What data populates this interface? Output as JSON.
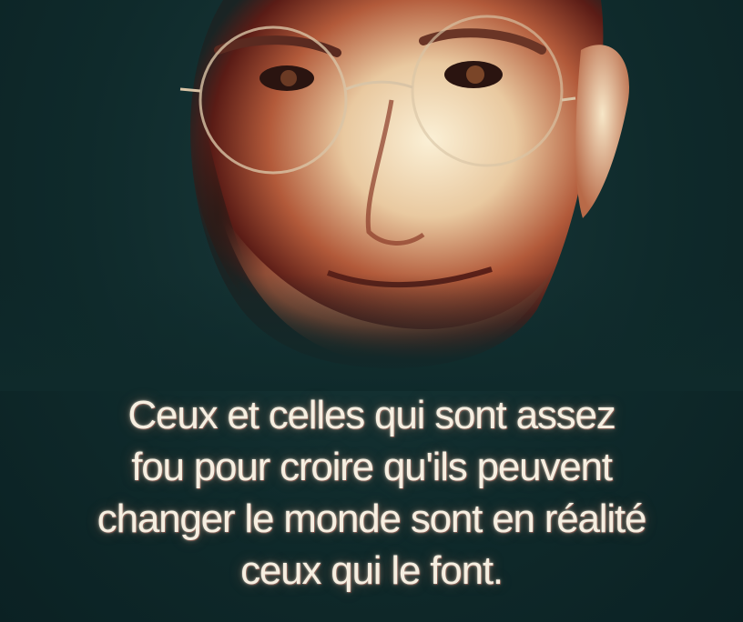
{
  "quote": {
    "lines": [
      "Ceux et celles qui sont assez",
      "fou pour croire qu'ils peuvent",
      "changer le monde sont en réalité",
      "ceux qui le font."
    ]
  },
  "colors": {
    "background": "#0f2a2b",
    "text": "#f6efe1",
    "skin_highlight": "#f3e3c4",
    "skin_shadow": "#8c2f22"
  }
}
